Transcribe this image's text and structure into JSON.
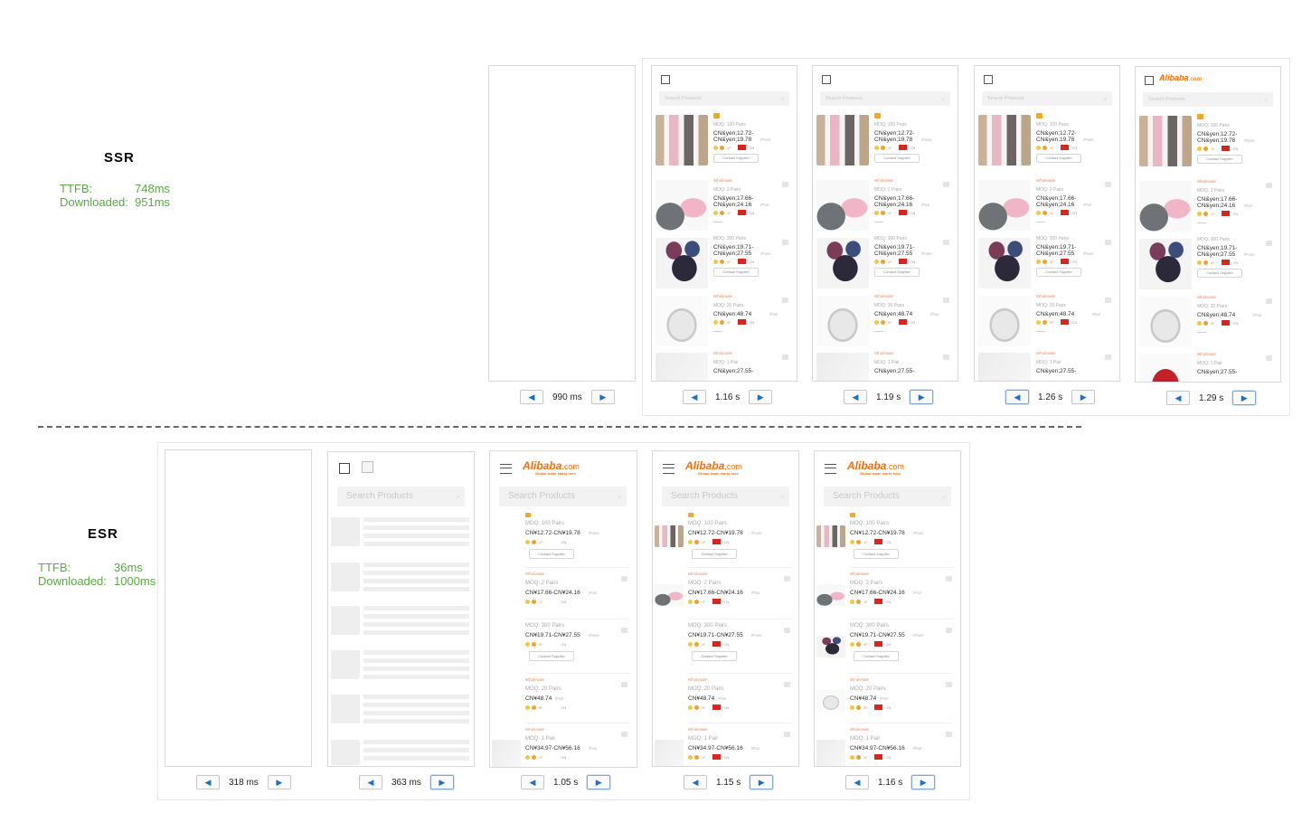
{
  "ssr": {
    "title": "SSR",
    "metrics": [
      {
        "label": "TTFB:",
        "value": "748ms"
      },
      {
        "label": "Downloaded:",
        "value": "951ms"
      }
    ]
  },
  "esr": {
    "title": "ESR",
    "metrics": [
      {
        "label": "TTFB:",
        "value": "36ms"
      },
      {
        "label": "Downloaded:",
        "value": "1000ms"
      }
    ]
  },
  "ssr_frames": [
    {
      "time": "990 ms",
      "state": "blank"
    },
    {
      "time": "1.16 s",
      "state": "list"
    },
    {
      "time": "1.19 s",
      "state": "list"
    },
    {
      "time": "1.26 s",
      "state": "list"
    },
    {
      "time": "1.29 s",
      "state": "list-logo"
    }
  ],
  "esr_frames": [
    {
      "time": "318 ms",
      "state": "blank"
    },
    {
      "time": "363 ms",
      "state": "skeleton"
    },
    {
      "time": "1.05 s",
      "state": "list"
    },
    {
      "time": "1.15 s",
      "state": "list"
    },
    {
      "time": "1.16 s",
      "state": "list"
    }
  ],
  "logo": {
    "text": "Alibaba",
    "suffix": ".com",
    "tagline": "Global trade starts here"
  },
  "search": {
    "placeholder": "Search Products"
  },
  "contact_label": "Contact Supplier",
  "wholesale_label": "Wholesale",
  "country": "CN",
  "ssr_products": [
    {
      "moq": "MOQ: 100 Pairs",
      "price": "CN&yen;12.72-",
      "price2": "CN&yen;19.78",
      "unit": "/Pairs",
      "years": "1ʸʳ",
      "badge": true,
      "wholesale": false,
      "contact": true
    },
    {
      "moq": "MOQ: 2 Pairs",
      "price": "CN&yen;17.66-",
      "price2": "CN&yen;24.16",
      "unit": "/Pair",
      "years": "1ʸʳ",
      "badge": false,
      "wholesale": true,
      "contact": false
    },
    {
      "moq": "MOQ: 300 Pairs",
      "price": "CN&yen;19.71-",
      "price2": "CN&yen;27.55",
      "unit": "/Pairs",
      "years": "4ʸʳ",
      "badge": false,
      "wholesale": false,
      "contact": true
    },
    {
      "moq": "MOQ: 20 Pairs",
      "price": "CN&yen;48.74",
      "price2": "",
      "unit": "/Pair",
      "years": "9ʸʳ",
      "badge": false,
      "wholesale": true,
      "contact": false
    },
    {
      "moq": "MOQ: 1 Pair",
      "price": "CN&yen;27.55-",
      "price2": "",
      "unit": "",
      "years": "",
      "badge": false,
      "wholesale": true,
      "contact": false
    }
  ],
  "esr_products": [
    {
      "moq": "MOQ: 100 Pairs",
      "price": "CN¥12.72-CN¥19.78",
      "unit": "/Pairs",
      "years": "1ʸʳ",
      "badge": true,
      "wholesale": false,
      "contact": true
    },
    {
      "moq": "MOQ: 2 Pairs",
      "price": "CN¥17.66-CN¥24.16",
      "unit": "/Pair",
      "years": "1ʸʳ",
      "badge": false,
      "wholesale": true,
      "contact": false
    },
    {
      "moq": "MOQ: 300 Pairs",
      "price": "CN¥19.71-CN¥27.55",
      "unit": "/Pairs",
      "years": "4ʸʳ",
      "badge": false,
      "wholesale": false,
      "contact": true
    },
    {
      "moq": "MOQ: 20 Pairs",
      "price": "CN¥48.74",
      "unit": "/Pair",
      "years": "9ʸʳ",
      "badge": false,
      "wholesale": true,
      "contact": false
    },
    {
      "moq": "MOQ: 1 Pair",
      "price": "CN¥34.97-CN¥56.16",
      "unit": "/Pair",
      "years": "1ʸʳ",
      "badge": false,
      "wholesale": true,
      "contact": false
    }
  ]
}
